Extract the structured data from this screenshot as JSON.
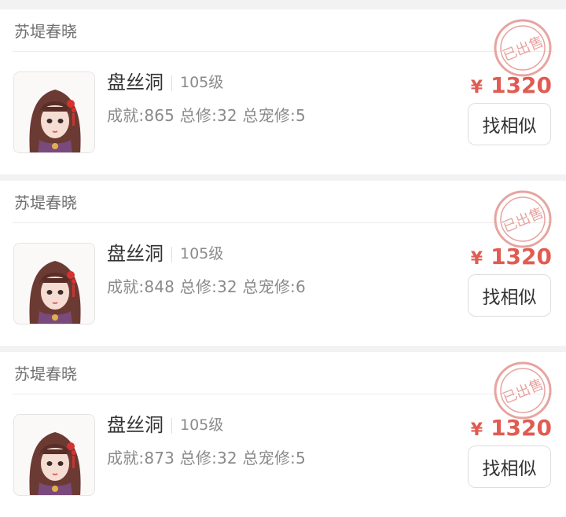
{
  "colors": {
    "background": "#f2f2f2",
    "card": "#ffffff",
    "price": "#e05b52",
    "stamp": "#e7a4a0"
  },
  "listings": [
    {
      "server": "苏堤春晓",
      "school": "盘丝洞",
      "level": "105级",
      "stats": "成就:865 总修:32 总宠修:5",
      "currency": "¥",
      "price": "1320",
      "action": "找相似",
      "stamp": "已出售"
    },
    {
      "server": "苏堤春晓",
      "school": "盘丝洞",
      "level": "105级",
      "stats": "成就:848 总修:32 总宠修:6",
      "currency": "¥",
      "price": "1320",
      "action": "找相似",
      "stamp": "已出售"
    },
    {
      "server": "苏堤春晓",
      "school": "盘丝洞",
      "level": "105级",
      "stats": "成就:873 总修:32 总宠修:5",
      "currency": "¥",
      "price": "1320",
      "action": "找相似",
      "stamp": "已出售"
    }
  ]
}
